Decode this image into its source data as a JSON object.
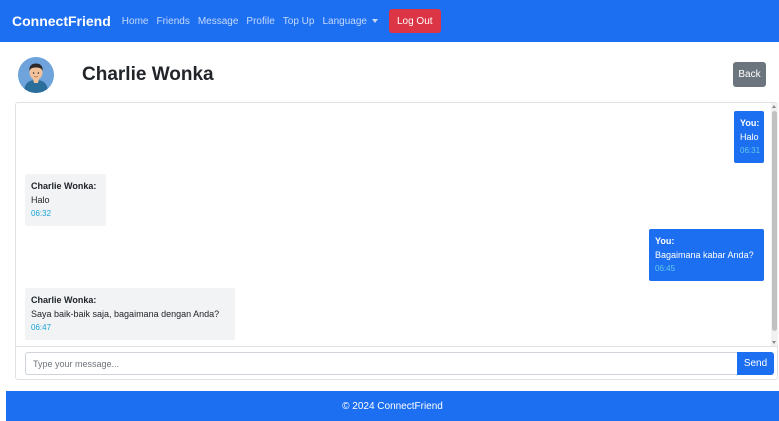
{
  "navbar": {
    "brand": "ConnectFriend",
    "links": [
      "Home",
      "Friends",
      "Message",
      "Profile",
      "Top Up"
    ],
    "language_label": "Language",
    "logout_label": "Log Out"
  },
  "header": {
    "contact_name": "Charlie Wonka",
    "back_label": "Back"
  },
  "messages": [
    {
      "sender": "You:",
      "text": "Halo",
      "time": "06:31",
      "from_me": true
    },
    {
      "sender": "Charlie Wonka:",
      "text": "Halo",
      "time": "06:32",
      "from_me": false
    },
    {
      "sender": "You:",
      "text": "Bagaimana kabar Anda?",
      "time": "06:45",
      "from_me": true
    },
    {
      "sender": "Charlie Wonka:",
      "text": "Saya baik-baik saja, bagaimana dengan Anda?",
      "time": "06:47",
      "from_me": false
    }
  ],
  "composer": {
    "placeholder": "Type your message...",
    "value": "",
    "send_label": "Send"
  },
  "footer": {
    "text": "© 2024 ConnectFriend"
  },
  "colors": {
    "primary": "#1d6ff2",
    "danger": "#dc3545",
    "secondary": "#6c757d",
    "incoming_bubble": "#f1f3f5",
    "time_incoming": "#1aa3d9",
    "time_outgoing": "#5fcbe6"
  },
  "icons": {
    "language_dropdown": "chevron-down-icon",
    "avatar": "user-avatar-icon"
  }
}
